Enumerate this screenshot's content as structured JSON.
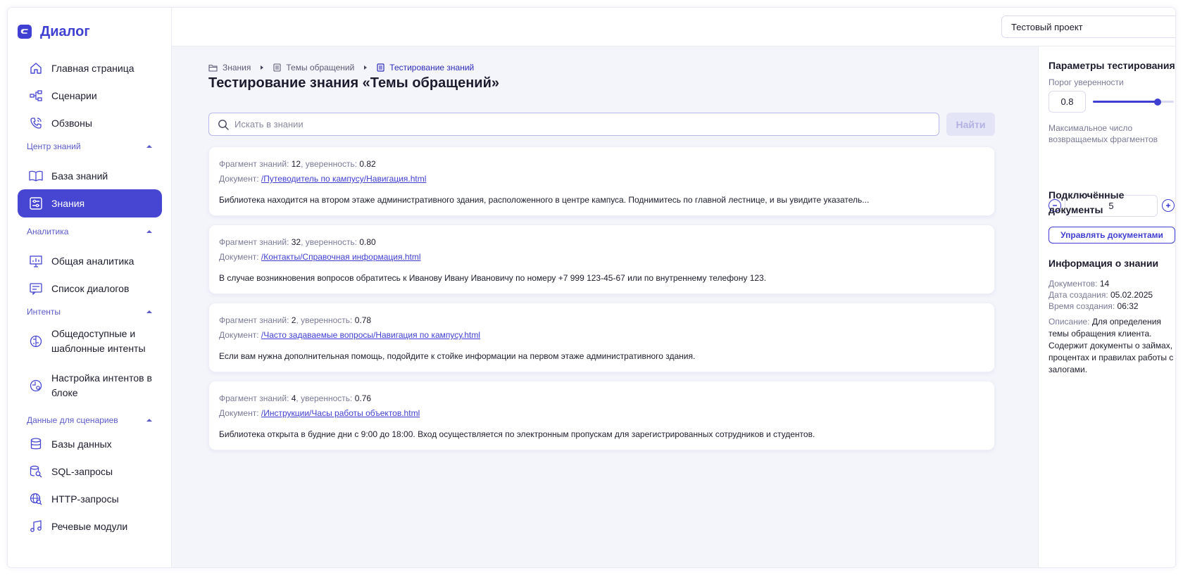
{
  "app": {
    "name": "Диалог"
  },
  "sidebar": {
    "top_items": [
      {
        "label": "Главная страница"
      },
      {
        "label": "Сценарии"
      },
      {
        "label": "Обзвоны"
      }
    ],
    "sections": [
      {
        "title": "Центр знаний",
        "items": [
          {
            "label": "База знаний"
          },
          {
            "label": "Знания",
            "active": true
          }
        ]
      },
      {
        "title": "Аналитика",
        "items": [
          {
            "label": "Общая аналитика"
          },
          {
            "label": "Список диалогов"
          }
        ]
      },
      {
        "title": "Интенты",
        "items": [
          {
            "label": "Общедоступные и шаблонные интенты"
          },
          {
            "label": "Настройка интентов в блоке"
          }
        ]
      },
      {
        "title": "Данные для сценариев",
        "items": [
          {
            "label": "Базы данных"
          },
          {
            "label": "SQL-запросы"
          },
          {
            "label": "HTTP-запросы"
          },
          {
            "label": "Речевые модули"
          }
        ]
      }
    ]
  },
  "topbar": {
    "project": "Тестовый проект"
  },
  "breadcrumb": [
    {
      "label": "Знания"
    },
    {
      "label": "Темы обращений"
    },
    {
      "label": "Тестирование знаний"
    }
  ],
  "page": {
    "title": "Тестирование знания «Темы обращений»",
    "search_placeholder": "Искать в знании",
    "search_value": "",
    "find_button": "Найти"
  },
  "labels": {
    "fragment": "Фрагмент знаний: ",
    "confidence": ", уверенность: ",
    "document": "Документ: "
  },
  "results": [
    {
      "fragment": "12",
      "confidence": "0.82",
      "doc": " /Путеводитель по кампусу/Навигация.html",
      "text": "Библиотека находится на втором этаже административного здания, расположенного в центре кампуса. Поднимитесь по главной лестнице, и вы увидите указатель..."
    },
    {
      "fragment": "32",
      "confidence": "0.80",
      "doc": "/Контакты/Справочная информация.html",
      "text": "В случае возникновения вопросов обратитесь к Иванову Ивану Ивановичу по номеру +7 999 123-45-67 или по внутреннему телефону 123."
    },
    {
      "fragment": "2",
      "confidence": "0.78",
      "doc": "/Часто задаваемые вопросы/Навигация по кампусу.html",
      "text": "Если вам нужна дополнительная помощь, подойдите к стойке информации на первом этаже административного здания."
    },
    {
      "fragment": "4",
      "confidence": "0.76",
      "doc": "/Инструкции/Часы работы объектов.html",
      "text": "Библиотека открыта в будние дни с 9:00 до 18:00. Вход осуществляется по электронным пропускам для зарегистрированных сотрудников и студентов."
    }
  ],
  "params": {
    "title": "Параметры тестирования",
    "threshold_label": "Порог уверенности",
    "threshold_value": "0.8",
    "threshold_fraction": 0.8,
    "max_label": "Максимальное число возвращаемых фрагментов",
    "max_value": "5",
    "docs_title": "Подключённые документы",
    "manage_button": "Управлять документами"
  },
  "info": {
    "title": "Информация о знании",
    "documents_label": "Документов: ",
    "documents": "14",
    "created_date_label": "Дата создания: ",
    "created_date": "05.02.2025",
    "created_time_label": "Время создания: ",
    "created_time": "06:32",
    "description_label": "Описание: ",
    "description": "Для определения темы обращения клиента. Содержит документы о займах, процентах и правилах работы с залогами."
  },
  "colors": {
    "accent": "#3f3fd1",
    "active_bg": "#4646d3"
  }
}
